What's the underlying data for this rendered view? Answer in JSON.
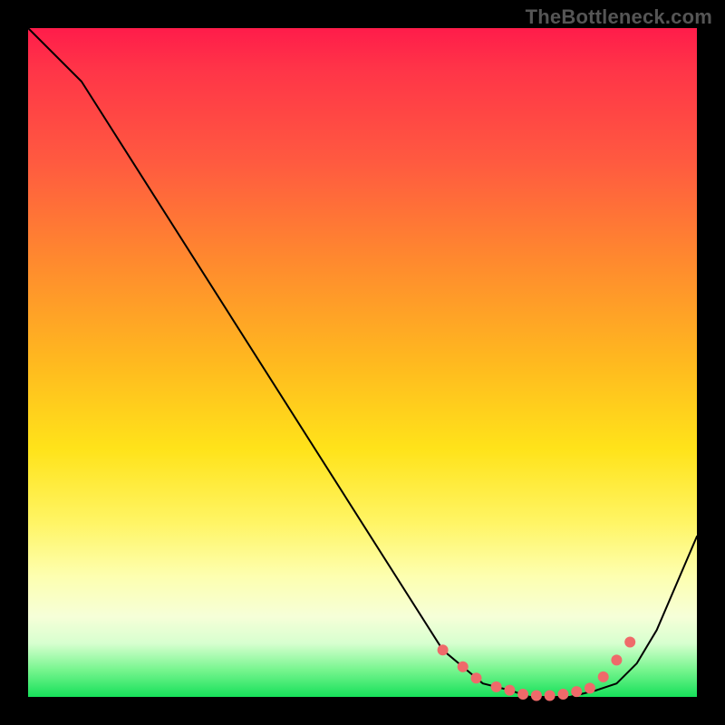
{
  "attribution": "TheBottleneck.com",
  "colors": {
    "frame": "#000000",
    "attribution_text": "#555555",
    "curve": "#000000",
    "dots": "#ef6a6a",
    "gradient_stops": [
      "#ff1c4a",
      "#ff5a40",
      "#ffb91f",
      "#fff565",
      "#16e05a"
    ]
  },
  "chart_data": {
    "type": "line",
    "title": "",
    "xlabel": "",
    "ylabel": "",
    "xlim": [
      0,
      100
    ],
    "ylim": [
      0,
      100
    ],
    "grid": false,
    "legend": false,
    "series": [
      {
        "name": "curve",
        "x": [
          0,
          8,
          62,
          68,
          72,
          75,
          78,
          81,
          85,
          88,
          91,
          94,
          100
        ],
        "values": [
          100,
          92,
          7,
          2,
          1,
          0,
          0,
          0,
          1,
          2,
          5,
          10,
          24
        ]
      }
    ],
    "highlight_points": {
      "name": "dots",
      "x": [
        62,
        65,
        67,
        70,
        72,
        74,
        76,
        78,
        80,
        82,
        84,
        86,
        88,
        90
      ],
      "values": [
        7,
        4.5,
        2.8,
        1.5,
        1.0,
        0.4,
        0.2,
        0.2,
        0.4,
        0.8,
        1.3,
        3.0,
        5.5,
        8.2
      ]
    }
  }
}
